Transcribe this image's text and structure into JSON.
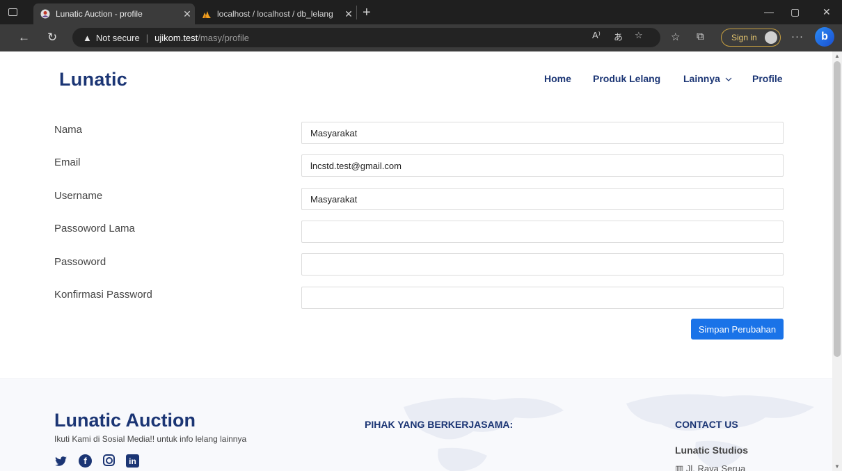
{
  "browser": {
    "tabs": [
      {
        "title": "Lunatic Auction - profile",
        "active": true
      },
      {
        "title": "localhost / localhost / db_lelang",
        "active": false
      }
    ],
    "address": {
      "security": "Not secure",
      "host": "ujikom.test",
      "path": "/masy/profile"
    },
    "sign_in": "Sign in"
  },
  "nav": {
    "brand": "Lunatic",
    "items": [
      "Home",
      "Produk Lelang",
      "Lainnya",
      "Profile"
    ]
  },
  "form": {
    "fields": [
      {
        "label": "Nama",
        "value": "Masyarakat"
      },
      {
        "label": "Email",
        "value": "lncstd.test@gmail.com"
      },
      {
        "label": "Username",
        "value": "Masyarakat"
      },
      {
        "label": "Passoword Lama",
        "value": ""
      },
      {
        "label": "Passoword",
        "value": ""
      },
      {
        "label": "Konfirmasi Password",
        "value": ""
      }
    ],
    "submit_label": "Simpan Perubahan"
  },
  "footer": {
    "title": "Lunatic Auction",
    "subtitle": "Ikuti Kami di Sosial Media!! untuk info lelang lainnya",
    "partners_heading": "PIHAK YANG BERKERJASAMA:",
    "contact_heading": "CONTACT US",
    "company": "Lunatic Studios",
    "address": "Jl. Raya Serua",
    "socials": [
      "twitter-icon",
      "facebook-icon",
      "instagram-icon",
      "linkedin-icon"
    ]
  },
  "colors": {
    "brand": "#1b3574",
    "primary_button": "#1a73e8"
  }
}
